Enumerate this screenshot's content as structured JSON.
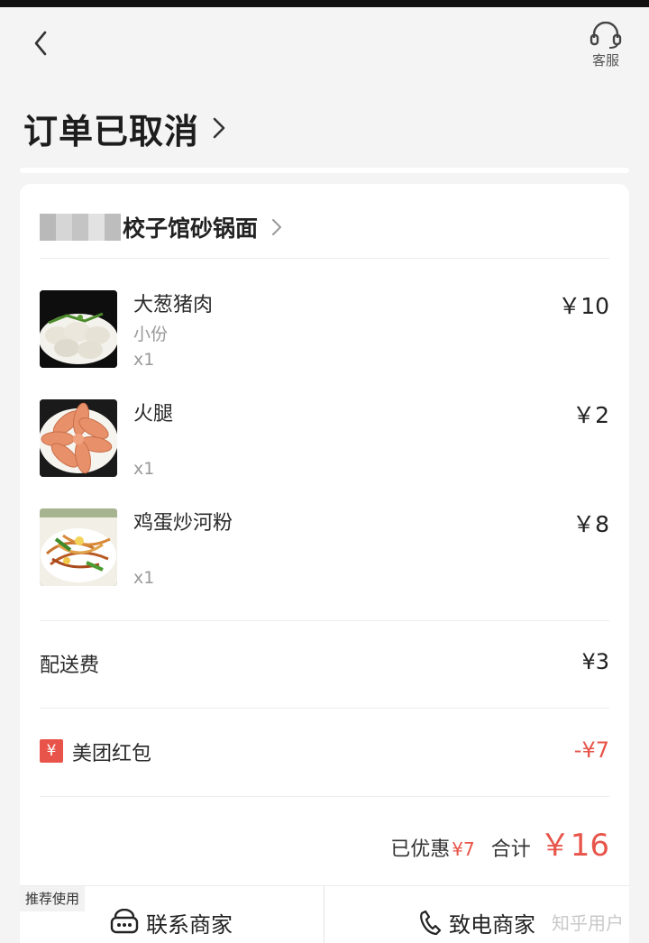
{
  "header": {
    "back_icon": "chevron-left-icon",
    "service_icon": "headset-icon",
    "service_label": "客服"
  },
  "order": {
    "status_title": "订单已取消"
  },
  "shop": {
    "name": "饺子馆砂锅面",
    "name_visible": "校子馆砂锅面"
  },
  "items": [
    {
      "name": "大葱猪肉",
      "spec": "小份",
      "qty": "x1",
      "price": "￥10"
    },
    {
      "name": "火腿",
      "spec": "",
      "qty": "x1",
      "price": "￥2"
    },
    {
      "name": "鸡蛋炒河粉",
      "spec": "",
      "qty": "x1",
      "price": "￥8"
    }
  ],
  "fees": {
    "delivery_label": "配送费",
    "delivery_value": "¥3",
    "redpacket_badge": "¥",
    "redpacket_label": "美团红包",
    "redpacket_value": "-¥7"
  },
  "summary": {
    "discount_label": "已优惠",
    "discount_value": "¥7",
    "total_label": "合计",
    "total_value": "￥16"
  },
  "bottom": {
    "recommend_badge": "推荐使用",
    "contact_label": "联系商家",
    "contact_icon": "chat-bubble-icon",
    "call_label": "致电商家",
    "call_icon": "phone-icon"
  },
  "watermark": "知乎用户",
  "colors": {
    "accent": "#e8544a",
    "background": "#f4f4f4",
    "card": "#ffffff"
  }
}
